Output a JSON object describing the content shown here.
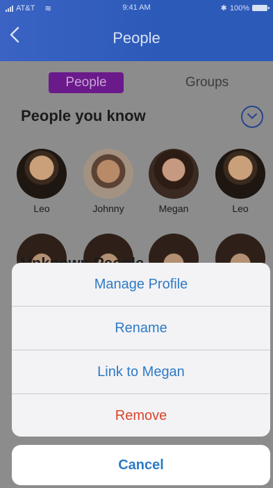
{
  "status_bar": {
    "carrier": "AT&T",
    "time": "9:41 AM",
    "bluetooth": "✱",
    "battery": "100%"
  },
  "nav": {
    "title": "People"
  },
  "segments": {
    "people": "People",
    "groups": "Groups"
  },
  "sections": {
    "known_title": "People you know",
    "second_title": "Unknown People"
  },
  "avatars": [
    {
      "name": "Leo"
    },
    {
      "name": "Johnny"
    },
    {
      "name": "Megan"
    },
    {
      "name": "Leo"
    }
  ],
  "action_sheet": {
    "items": [
      {
        "label": "Manage Profile"
      },
      {
        "label": "Rename"
      },
      {
        "label": "Link to Megan"
      },
      {
        "label": "Remove"
      }
    ],
    "cancel": "Cancel"
  },
  "colors": {
    "header": "#2c5ab8",
    "accent": "#2d7ac6",
    "destructive": "#d9432c",
    "segment_active": "#6a1a8a"
  }
}
